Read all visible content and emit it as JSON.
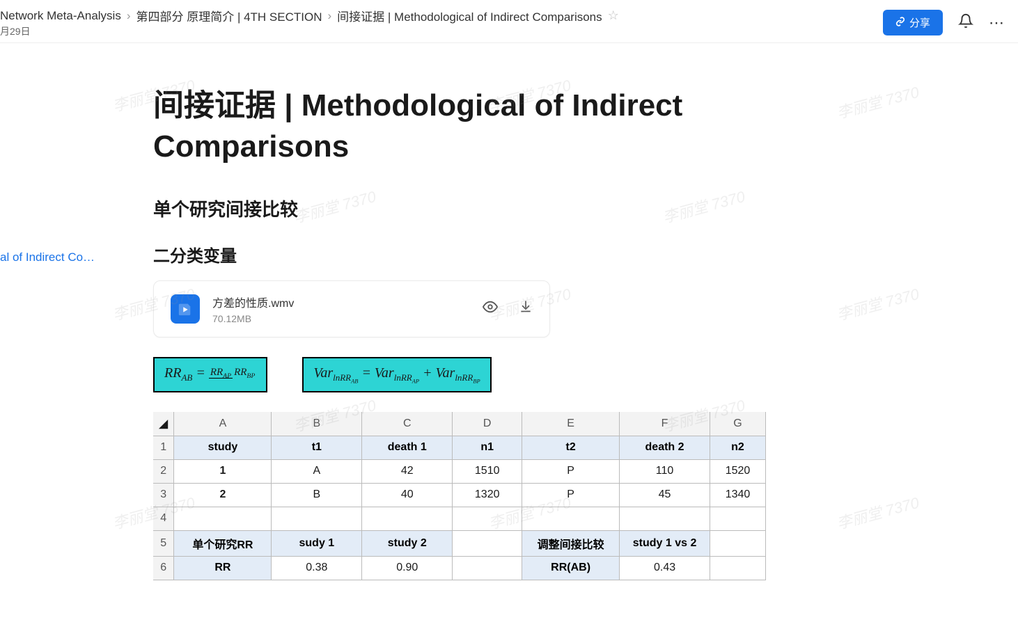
{
  "breadcrumb": {
    "items": [
      "Network Meta-Analysis",
      "第四部分 原理简介 | 4TH SECTION",
      "间接证据 | Methodological of Indirect Comparisons"
    ]
  },
  "date_fragment": "月29日",
  "share_label": "分享",
  "left_fragment": "al of Indirect Co…",
  "page_title": "间接证据 | Methodological of Indirect Comparisons",
  "heading2": "单个研究间接比较",
  "heading3": "二分类变量",
  "file": {
    "name": "方差的性质.wmv",
    "size": "70.12MB"
  },
  "formula1_html": "RR<sub>AB</sub> = <span class=\"frac\"><span class=\"num\">RR<sub>AP</sub></span><span class=\"den\">RR<sub>BP</sub></span></span>",
  "formula2_html": "Var<sub>lnRR<sub>AB</sub></sub> = Var<sub>lnRR<sub>AP</sub></sub> + Var<sub>lnRR<sub>BP</sub></sub>",
  "chart_data": {
    "type": "table",
    "columns": [
      "A",
      "B",
      "C",
      "D",
      "E",
      "F",
      "G"
    ],
    "header_row": [
      "study",
      "t1",
      "death 1",
      "n1",
      "t2",
      "death 2",
      "n2"
    ],
    "rows": [
      [
        "1",
        "A",
        "42",
        "1510",
        "P",
        "110",
        "1520"
      ],
      [
        "2",
        "B",
        "40",
        "1320",
        "P",
        "45",
        "1340"
      ]
    ],
    "rr_section": {
      "row5": {
        "a": "单个研究RR",
        "b": "sudy 1",
        "c": "study 2",
        "e": "调整间接比较",
        "f": "study 1 vs 2"
      },
      "row6": {
        "a": "RR",
        "b": "0.38",
        "c": "0.90",
        "e": "RR(AB)",
        "f": "0.43"
      }
    }
  },
  "watermark_text": "李丽堂 7370"
}
